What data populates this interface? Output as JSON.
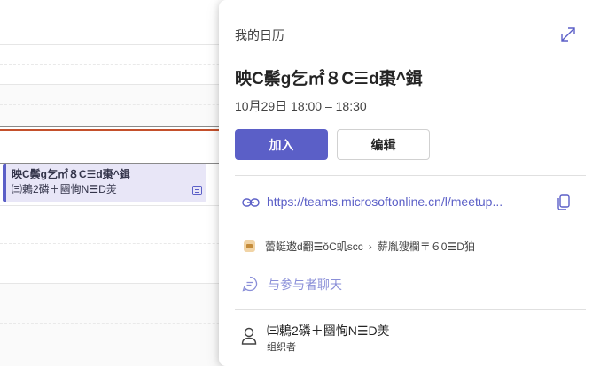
{
  "calendar": {
    "event": {
      "title": "映C鬃g乞㎡８C☰d棗^鍓",
      "subtitle": "㈢鶇2磷＋圝恂N☰D羙"
    }
  },
  "popup": {
    "calendar_name": "我的日历",
    "title": "映C鬃g乞㎡８C☰d棗^鍓",
    "time": "10月29日 18:00 – 18:30",
    "join_label": "加入",
    "edit_label": "编辑",
    "meeting_link": "https://teams.microsoftonline.cn/l/meetup...",
    "channel_team": "蕾蜓遨d翻☰ŏC虮scc",
    "channel_name": "薪胤獀欄〒６0☰D狛",
    "chat_label": "与参与者聊天",
    "organizer_name": "㈢鶇2磷＋圝恂N☰D羙",
    "organizer_role": "组织者"
  },
  "colors": {
    "accent": "#5b5fc7",
    "event_bg": "#e8e6f7",
    "now_line": "#c4502b"
  },
  "icons": [
    "expand-icon",
    "link-icon",
    "copy-icon",
    "channel-icon",
    "chat-icon",
    "person-icon",
    "notes-icon"
  ]
}
